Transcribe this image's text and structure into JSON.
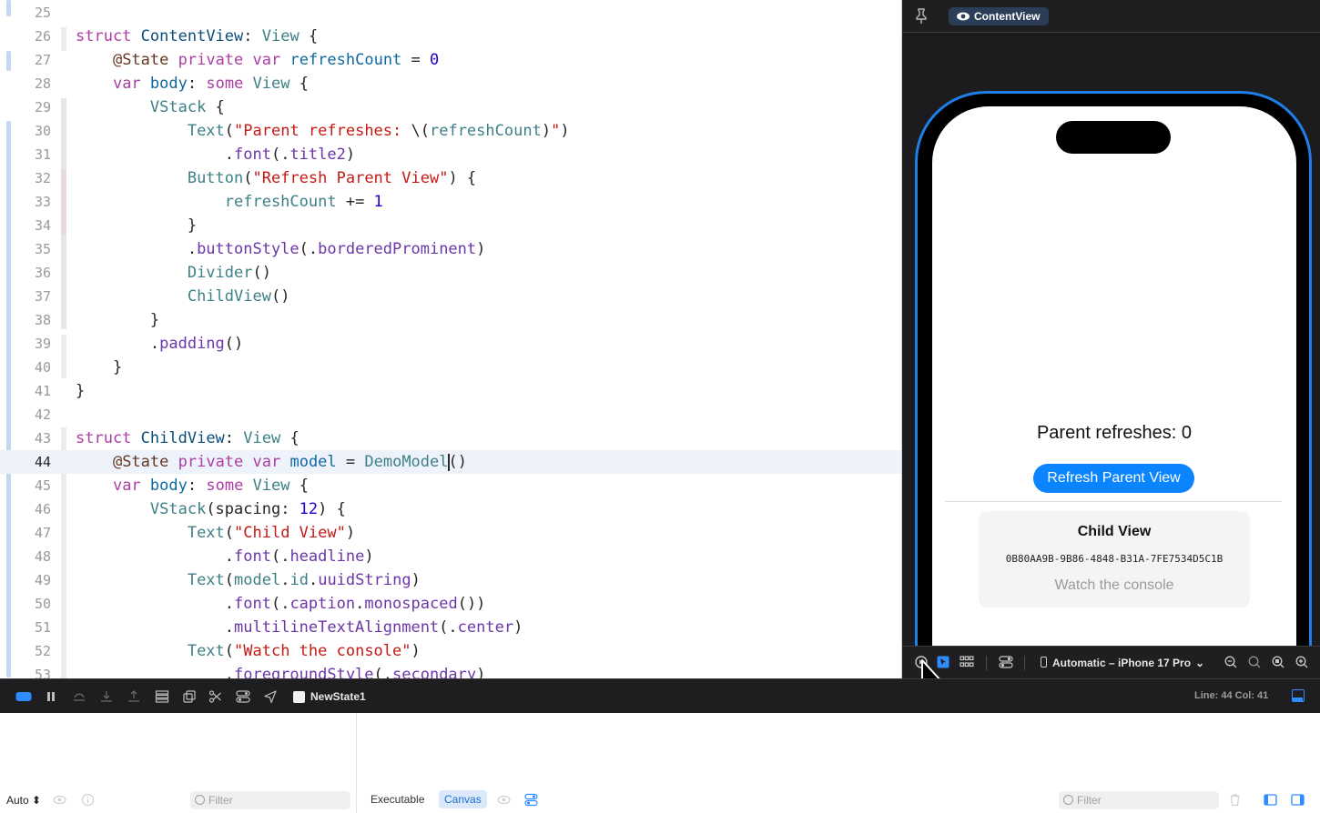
{
  "editor": {
    "current_line": "44",
    "lines": [
      {
        "n": "25",
        "tokens": []
      },
      {
        "n": "26",
        "tokens": [
          [
            "kw",
            "struct"
          ],
          [
            "pl",
            " "
          ],
          [
            "type",
            "ContentView"
          ],
          [
            "pl",
            ": "
          ],
          [
            "ntype",
            "View"
          ],
          [
            "pl",
            " {"
          ]
        ]
      },
      {
        "n": "27",
        "tokens": [
          [
            "pl",
            "    "
          ],
          [
            "attr",
            "@State"
          ],
          [
            "pl",
            " "
          ],
          [
            "kw",
            "private var"
          ],
          [
            "pl",
            " "
          ],
          [
            "var",
            "refreshCount"
          ],
          [
            "pl",
            " = "
          ],
          [
            "num",
            "0"
          ]
        ]
      },
      {
        "n": "28",
        "tokens": [
          [
            "pl",
            "    "
          ],
          [
            "kw",
            "var"
          ],
          [
            "pl",
            " "
          ],
          [
            "var",
            "body"
          ],
          [
            "pl",
            ": "
          ],
          [
            "kw",
            "some"
          ],
          [
            "pl",
            " "
          ],
          [
            "ntype",
            "View"
          ],
          [
            "pl",
            " {"
          ]
        ]
      },
      {
        "n": "29",
        "tokens": [
          [
            "pl",
            "        "
          ],
          [
            "ntype",
            "VStack"
          ],
          [
            "pl",
            " {"
          ]
        ]
      },
      {
        "n": "30",
        "tokens": [
          [
            "pl",
            "            "
          ],
          [
            "ntype",
            "Text"
          ],
          [
            "pl",
            "("
          ],
          [
            "str",
            "\"Parent refreshes: "
          ],
          [
            "pl",
            "\\("
          ],
          [
            "ntype",
            "refreshCount"
          ],
          [
            "pl",
            ")"
          ],
          [
            "str",
            "\""
          ],
          [
            "pl",
            ")"
          ]
        ]
      },
      {
        "n": "31",
        "tokens": [
          [
            "pl",
            "                ."
          ],
          [
            "fn",
            "font"
          ],
          [
            "pl",
            "(."
          ],
          [
            "fn",
            "title2"
          ],
          [
            "pl",
            ")"
          ]
        ]
      },
      {
        "n": "32",
        "tokens": [
          [
            "pl",
            "            "
          ],
          [
            "ntype",
            "Button"
          ],
          [
            "pl",
            "("
          ],
          [
            "str",
            "\"Refresh Parent View\""
          ],
          [
            "pl",
            ") {"
          ]
        ]
      },
      {
        "n": "33",
        "tokens": [
          [
            "pl",
            "                "
          ],
          [
            "ntype",
            "refreshCount"
          ],
          [
            "pl",
            " += "
          ],
          [
            "num",
            "1"
          ]
        ]
      },
      {
        "n": "34",
        "tokens": [
          [
            "pl",
            "            }"
          ]
        ]
      },
      {
        "n": "35",
        "tokens": [
          [
            "pl",
            "            ."
          ],
          [
            "fn",
            "buttonStyle"
          ],
          [
            "pl",
            "(."
          ],
          [
            "fn",
            "borderedProminent"
          ],
          [
            "pl",
            ")"
          ]
        ]
      },
      {
        "n": "36",
        "tokens": [
          [
            "pl",
            "            "
          ],
          [
            "ntype",
            "Divider"
          ],
          [
            "pl",
            "()"
          ]
        ]
      },
      {
        "n": "37",
        "tokens": [
          [
            "pl",
            "            "
          ],
          [
            "ntype",
            "ChildView"
          ],
          [
            "pl",
            "()"
          ]
        ]
      },
      {
        "n": "38",
        "tokens": [
          [
            "pl",
            "        }"
          ]
        ]
      },
      {
        "n": "39",
        "tokens": [
          [
            "pl",
            "        ."
          ],
          [
            "fn",
            "padding"
          ],
          [
            "pl",
            "()"
          ]
        ]
      },
      {
        "n": "40",
        "tokens": [
          [
            "pl",
            "    }"
          ]
        ]
      },
      {
        "n": "41",
        "tokens": [
          [
            "pl",
            "}"
          ]
        ]
      },
      {
        "n": "42",
        "tokens": []
      },
      {
        "n": "43",
        "tokens": [
          [
            "kw",
            "struct"
          ],
          [
            "pl",
            " "
          ],
          [
            "type",
            "ChildView"
          ],
          [
            "pl",
            ": "
          ],
          [
            "ntype",
            "View"
          ],
          [
            "pl",
            " {"
          ]
        ]
      },
      {
        "n": "44",
        "tokens": [
          [
            "pl",
            "    "
          ],
          [
            "attr",
            "@State"
          ],
          [
            "pl",
            " "
          ],
          [
            "kw",
            "private var"
          ],
          [
            "pl",
            " "
          ],
          [
            "var",
            "model"
          ],
          [
            "pl",
            " = "
          ],
          [
            "ntype",
            "DemoModel"
          ],
          [
            "caret",
            ""
          ],
          [
            "pl",
            "()"
          ]
        ]
      },
      {
        "n": "45",
        "tokens": [
          [
            "pl",
            "    "
          ],
          [
            "kw",
            "var"
          ],
          [
            "pl",
            " "
          ],
          [
            "var",
            "body"
          ],
          [
            "pl",
            ": "
          ],
          [
            "kw",
            "some"
          ],
          [
            "pl",
            " "
          ],
          [
            "ntype",
            "View"
          ],
          [
            "pl",
            " {"
          ]
        ]
      },
      {
        "n": "46",
        "tokens": [
          [
            "pl",
            "        "
          ],
          [
            "ntype",
            "VStack"
          ],
          [
            "pl",
            "(spacing: "
          ],
          [
            "num",
            "12"
          ],
          [
            "pl",
            ") {"
          ]
        ]
      },
      {
        "n": "47",
        "tokens": [
          [
            "pl",
            "            "
          ],
          [
            "ntype",
            "Text"
          ],
          [
            "pl",
            "("
          ],
          [
            "str",
            "\"Child View\""
          ],
          [
            "pl",
            ")"
          ]
        ]
      },
      {
        "n": "48",
        "tokens": [
          [
            "pl",
            "                ."
          ],
          [
            "fn",
            "font"
          ],
          [
            "pl",
            "(."
          ],
          [
            "fn",
            "headline"
          ],
          [
            "pl",
            ")"
          ]
        ]
      },
      {
        "n": "49",
        "tokens": [
          [
            "pl",
            "            "
          ],
          [
            "ntype",
            "Text"
          ],
          [
            "pl",
            "("
          ],
          [
            "ntype",
            "model"
          ],
          [
            "pl",
            "."
          ],
          [
            "ntype",
            "id"
          ],
          [
            "pl",
            "."
          ],
          [
            "fn",
            "uuidString"
          ],
          [
            "pl",
            ")"
          ]
        ]
      },
      {
        "n": "50",
        "tokens": [
          [
            "pl",
            "                ."
          ],
          [
            "fn",
            "font"
          ],
          [
            "pl",
            "(."
          ],
          [
            "fn",
            "caption"
          ],
          [
            "pl",
            "."
          ],
          [
            "fn",
            "monospaced"
          ],
          [
            "pl",
            "())"
          ]
        ]
      },
      {
        "n": "51",
        "tokens": [
          [
            "pl",
            "                ."
          ],
          [
            "fn",
            "multilineTextAlignment"
          ],
          [
            "pl",
            "(."
          ],
          [
            "fn",
            "center"
          ],
          [
            "pl",
            ")"
          ]
        ]
      },
      {
        "n": "52",
        "tokens": [
          [
            "pl",
            "            "
          ],
          [
            "ntype",
            "Text"
          ],
          [
            "pl",
            "("
          ],
          [
            "str",
            "\"Watch the console\""
          ],
          [
            "pl",
            ")"
          ]
        ]
      },
      {
        "n": "53",
        "tokens": [
          [
            "pl",
            "                ."
          ],
          [
            "fn",
            "foregroundStyle"
          ],
          [
            "pl",
            "(."
          ],
          [
            "fn",
            "secondary"
          ],
          [
            "pl",
            ")"
          ]
        ]
      }
    ]
  },
  "canvas": {
    "preview_name": "ContentView",
    "device_label": "Automatic – iPhone 17 Pro",
    "preview": {
      "parent_title": "Parent refreshes: 0",
      "refresh_button": "Refresh Parent View",
      "child_title": "Child View",
      "child_uuid": "0B80AA9B-9B86-4848-B31A-7FE7534D5C1B",
      "child_watch": "Watch the console"
    }
  },
  "debug_bar": {
    "scheme": "NewState1",
    "line_col": "Line: 44  Col: 41"
  },
  "console": {
    "auto_label": "Auto ⬍",
    "filter_left_placeholder": "Filter",
    "executable_tab": "Executable",
    "canvas_tab": "Canvas",
    "filter_right_placeholder": "Filter"
  },
  "colors": {
    "accent": "#0a84ff",
    "device_border": "#1f7fe8"
  }
}
